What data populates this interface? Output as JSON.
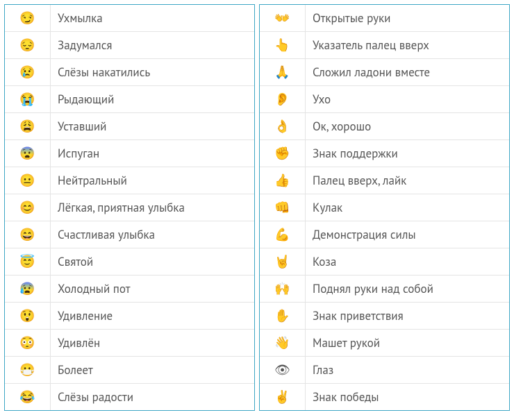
{
  "left": {
    "rows": [
      {
        "icon": "😏",
        "icon_name": "Ухмылка",
        "label": "Ухмылка"
      },
      {
        "icon": "😔",
        "icon_name": "Задумался",
        "label": "Задумался"
      },
      {
        "icon": "😢",
        "icon_name": "Слёзы накатились",
        "label": "Слёзы накатились"
      },
      {
        "icon": "😭",
        "icon_name": "Рыдающий",
        "label": "Рыдающий"
      },
      {
        "icon": "😩",
        "icon_name": "Уставший",
        "label": "Уставший"
      },
      {
        "icon": "😨",
        "icon_name": "Испуган",
        "label": "Испуган"
      },
      {
        "icon": "😐",
        "icon_name": "Нейтральный",
        "label": "Нейтральный"
      },
      {
        "icon": "😊",
        "icon_name": "Лёгкая, приятная улыбка",
        "label": "Лёгкая, приятная улыбка"
      },
      {
        "icon": "😄",
        "icon_name": "Счастливая улыбка",
        "label": "Счастливая улыбка"
      },
      {
        "icon": "😇",
        "icon_name": "Святой",
        "label": "Святой"
      },
      {
        "icon": "😰",
        "icon_name": "Холодный пот",
        "label": "Холодный пот"
      },
      {
        "icon": "😲",
        "icon_name": "Удивление",
        "label": "Удивление"
      },
      {
        "icon": "😳",
        "icon_name": "Удивлён",
        "label": "Удивлён"
      },
      {
        "icon": "😷",
        "icon_name": "Болеет",
        "label": "Болеет"
      },
      {
        "icon": "😂",
        "icon_name": "Слёзы радости",
        "label": "Слёзы радости"
      }
    ]
  },
  "right": {
    "rows": [
      {
        "icon": "👐",
        "icon_name": "Открытые руки",
        "label": "Открытые руки"
      },
      {
        "icon": "👆",
        "icon_name": "Указатель палец вверх",
        "label": "Указатель палец вверх"
      },
      {
        "icon": "🙏",
        "icon_name": "Сложил ладони вместе",
        "label": "Сложил ладони вместе"
      },
      {
        "icon": "👂",
        "icon_name": "Ухо",
        "label": "Ухо"
      },
      {
        "icon": "👌",
        "icon_name": "Ок, хорошо",
        "label": "Ок, хорошо"
      },
      {
        "icon": "✊",
        "icon_name": "Знак поддержки",
        "label": "Знак поддержки"
      },
      {
        "icon": "👍",
        "icon_name": "Палец вверх, лайк",
        "label": "Палец вверх, лайк"
      },
      {
        "icon": "👊",
        "icon_name": "Кулак",
        "label": "Кулак"
      },
      {
        "icon": "💪",
        "icon_name": "Демонстрация силы",
        "label": "Демонстрация силы"
      },
      {
        "icon": "🤘",
        "icon_name": "Коза",
        "label": "Коза"
      },
      {
        "icon": "🙌",
        "icon_name": "Поднял руки над собой",
        "label": "Поднял руки над собой"
      },
      {
        "icon": "✋",
        "icon_name": "Знак приветствия",
        "label": "Знак приветствия"
      },
      {
        "icon": "👋",
        "icon_name": "Машет рукой",
        "label": "Машет рукой"
      },
      {
        "icon": "👁",
        "icon_name": "Глаз",
        "label": "Глаз"
      },
      {
        "icon": "✌",
        "icon_name": "Знак победы",
        "label": "Знак победы"
      }
    ]
  }
}
